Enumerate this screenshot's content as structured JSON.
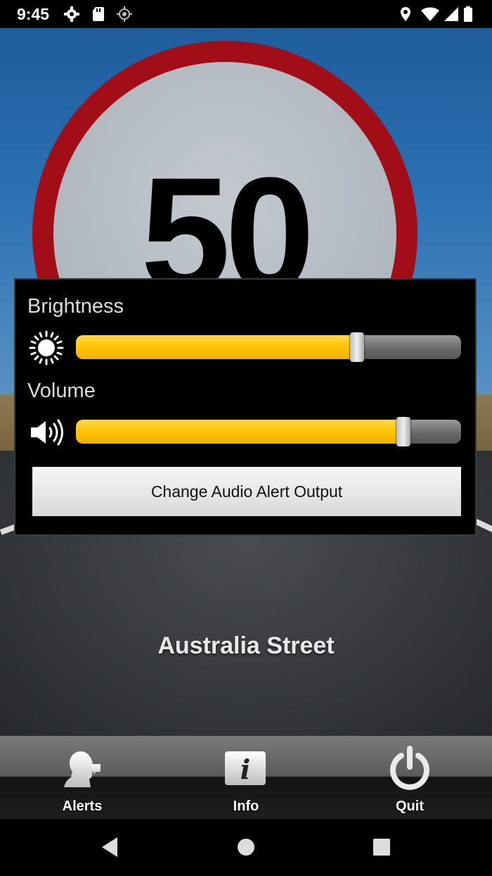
{
  "status_bar": {
    "time": "9:45",
    "icons": [
      "gear-icon",
      "sd-card-icon",
      "location-crosshair-icon",
      "location-pin-icon",
      "wifi-icon",
      "signal-icon",
      "battery-icon"
    ]
  },
  "sign": {
    "speed_limit": "50"
  },
  "dialog": {
    "brightness_label": "Brightness",
    "brightness_level": 0.73,
    "volume_label": "Volume",
    "volume_level": 0.85,
    "button_label": "Change Audio Alert Output"
  },
  "street_name": "Australia Street",
  "toolbar": {
    "items": [
      {
        "label": "Alerts",
        "icon": "speaking-person-icon"
      },
      {
        "label": "Info",
        "icon": "info-icon"
      },
      {
        "label": "Quit",
        "icon": "power-icon"
      }
    ]
  },
  "navbar": {
    "icons": [
      "back-icon",
      "home-icon",
      "recents-icon"
    ]
  },
  "colors": {
    "slider_fill": "#ffc400",
    "sign_ring": "#a10e18"
  }
}
